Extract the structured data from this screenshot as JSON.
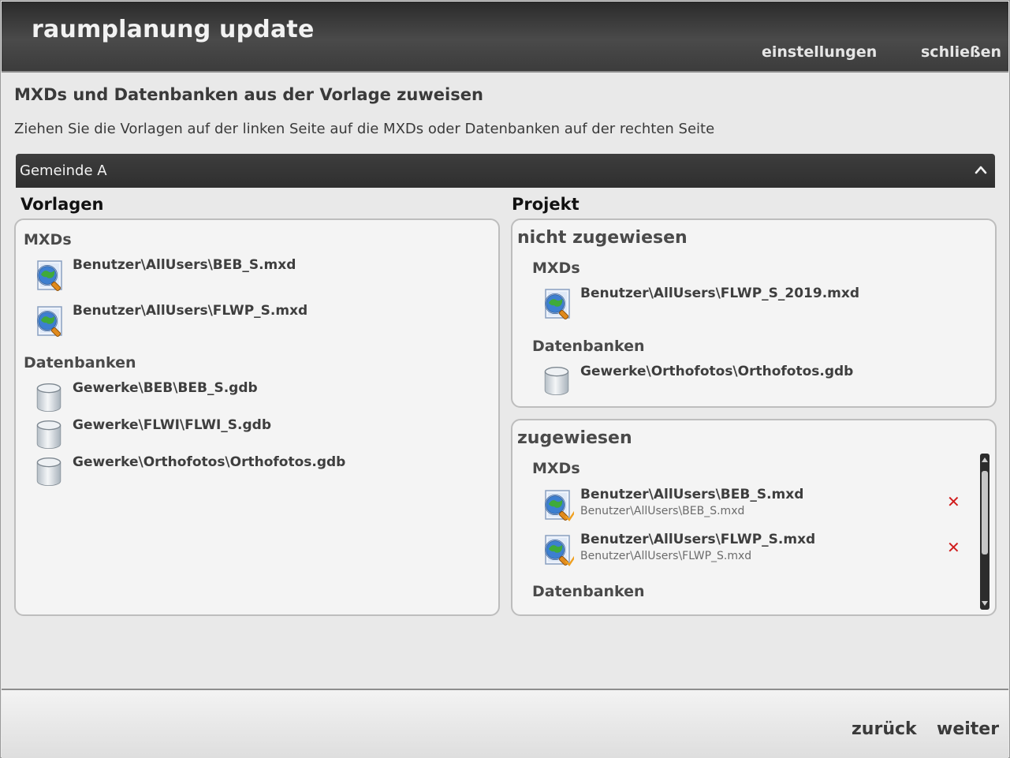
{
  "header": {
    "app_title": "raumplanung update",
    "settings_label": "einstellungen",
    "close_label": "schließen"
  },
  "page": {
    "title": "MXDs und Datenbanken aus der Vorlage zuweisen",
    "subtitle": "Ziehen Sie die Vorlagen auf der linken Seite auf die MXDs oder Datenbanken auf der rechten Seite"
  },
  "group": {
    "label": "Gemeinde A",
    "icon": "chevron-up-icon"
  },
  "templates": {
    "heading": "Vorlagen",
    "mxd_heading": "MXDs",
    "mxds": [
      {
        "name": "Benutzer\\AllUsers\\BEB_S.mxd",
        "icon": "map-document-icon"
      },
      {
        "name": "Benutzer\\AllUsers\\FLWP_S.mxd",
        "icon": "map-document-icon"
      }
    ],
    "db_heading": "Datenbanken",
    "databases": [
      {
        "name": "Gewerke\\BEB\\BEB_S.gdb",
        "icon": "database-icon"
      },
      {
        "name": "Gewerke\\FLWI\\FLWI_S.gdb",
        "icon": "database-icon"
      },
      {
        "name": "Gewerke\\Orthofotos\\Orthofotos.gdb",
        "icon": "database-icon"
      }
    ]
  },
  "project": {
    "heading": "Projekt",
    "unassigned": {
      "heading": "nicht zugewiesen",
      "mxd_heading": "MXDs",
      "mxds": [
        {
          "name": "Benutzer\\AllUsers\\FLWP_S_2019.mxd",
          "icon": "map-document-icon"
        }
      ],
      "db_heading": "Datenbanken",
      "databases": [
        {
          "name": "Gewerke\\Orthofotos\\Orthofotos.gdb",
          "icon": "database-icon"
        }
      ]
    },
    "assigned": {
      "heading": "zugewiesen",
      "mxd_heading": "MXDs",
      "mxds": [
        {
          "name": "Benutzer\\AllUsers\\BEB_S.mxd",
          "source": "Benutzer\\AllUsers\\BEB_S.mxd",
          "icon": "map-document-checked-icon",
          "remove_label": "✕"
        },
        {
          "name": "Benutzer\\AllUsers\\FLWP_S.mxd",
          "source": "Benutzer\\AllUsers\\FLWP_S.mxd",
          "icon": "map-document-checked-icon",
          "remove_label": "✕"
        }
      ],
      "db_heading": "Datenbanken"
    }
  },
  "footer": {
    "back_label": "zurück",
    "next_label": "weiter"
  },
  "colors": {
    "header_bg": "#3c3c3c",
    "remove_red": "#d01c1c",
    "check_orange": "#f0a020"
  }
}
